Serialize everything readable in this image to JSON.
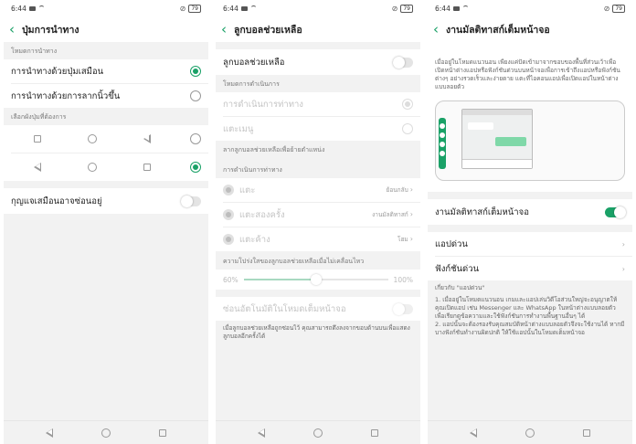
{
  "status": {
    "time": "6:44",
    "battery": "79"
  },
  "colors": {
    "accent": "#1aa167"
  },
  "screen1": {
    "title": "ปุ่มการนำทาง",
    "section_mode": "โหมดการนำทาง",
    "option_virtual": "การนำทางด้วยปุ่มเสมือน",
    "option_gesture": "การนำทางด้วยการลากนิ้วขึ้น",
    "section_layout": "เลือกผังปุ่มที่ต้องการ",
    "layout_row1_keys": [
      "square",
      "circle",
      "triangle"
    ],
    "layout_row2_keys": [
      "triangle",
      "circle",
      "square"
    ],
    "layout_selected": 2,
    "hide_keys_label": "กุญแจเสมือนอาจซ่อนอยู่",
    "hide_keys_on": false
  },
  "screen2": {
    "title": "ลูกบอลช่วยเหลือ",
    "main_toggle_label": "ลูกบอลช่วยเหลือ",
    "main_toggle_on": false,
    "section_op_mode": "โหมดการดำเนินการ",
    "op_gesture": "การดำเนินการท่าทาง",
    "op_menu": "แตะเมนู",
    "drag_hint": "ลากลูกบอลช่วยเหลือเพื่อย้ายตำแหน่ง",
    "section_gesture_op": "การดำเนินการท่าทาง",
    "gestures": [
      {
        "label": "แตะ",
        "value": "ย้อนกลับ"
      },
      {
        "label": "แตะสองครั้ง",
        "value": "งานมัลติทาสก์"
      },
      {
        "label": "แตะค้าง",
        "value": "โฮม"
      }
    ],
    "transparency_label": "ความโปร่งใสของลูกบอลช่วยเหลือเมื่อไม่เคลื่อนไหว",
    "slider_min": "60%",
    "slider_max": "100%",
    "slider_fraction": 0.5,
    "auto_hide_label": "ซ่อนอัตโนมัติในโหมดเต็มหน้าจอ",
    "auto_hide_on": false,
    "footer_note": "เมื่อลูกบอลช่วยเหลือถูกซ่อนไว้ คุณสามารถดึงลงจากขอบด้านบนเพื่อแสดงลูกบอลอีกครั้งได้"
  },
  "screen3": {
    "title": "งานมัลติทาสก์เต็มหน้าจอ",
    "intro": "เมื่ออยู่ในโหมดแนวนอน เพียงแค่ปัดเข้ามาจากขอบของพื้นที่ส่วนเว้าเพื่อเปิดหน้าต่างแอปหรือฟังก์ชันด่วนบนหน้าจอเพื่อการเข้าถึงแอปหรือฟังก์ชันต่างๆ อย่างรวดเร็วและง่ายดาย แตะที่ไอคอนแอปเพื่อเปิดแอปในหน้าต่างแบบลอยตัว",
    "toggle_label": "งานมัลติทาสก์เต็มหน้าจอ",
    "toggle_on": true,
    "quick_apps": "แอปด่วน",
    "quick_functions": "ฟังก์ชันด่วน",
    "about_title": "เกี่ยวกับ \"แอปด่วน\"",
    "about_1": "1. เมื่ออยู่ในโหมดแนวนอน เกมและแอปเล่นวิดีโอส่วนใหญ่จะอนุญาตให้คุณเปิดแอป เช่น Messenger และ WhatsApp ในหน้าต่างแบบลอยตัวเพื่อเรียกดูข้อความและใช้ฟังก์ชันการทำงานพื้นฐานอื่นๆ ได้",
    "about_2": "2. แอปนั้นจะต้องรองรับคุณสมบัติหน้าต่างแบบลอยตัวจึงจะใช้งานได้ หากมีบางฟังก์ชันทำงานผิดปกติ ให้ใช้แอปนั้นในโหมดเต็มหน้าจอ"
  }
}
